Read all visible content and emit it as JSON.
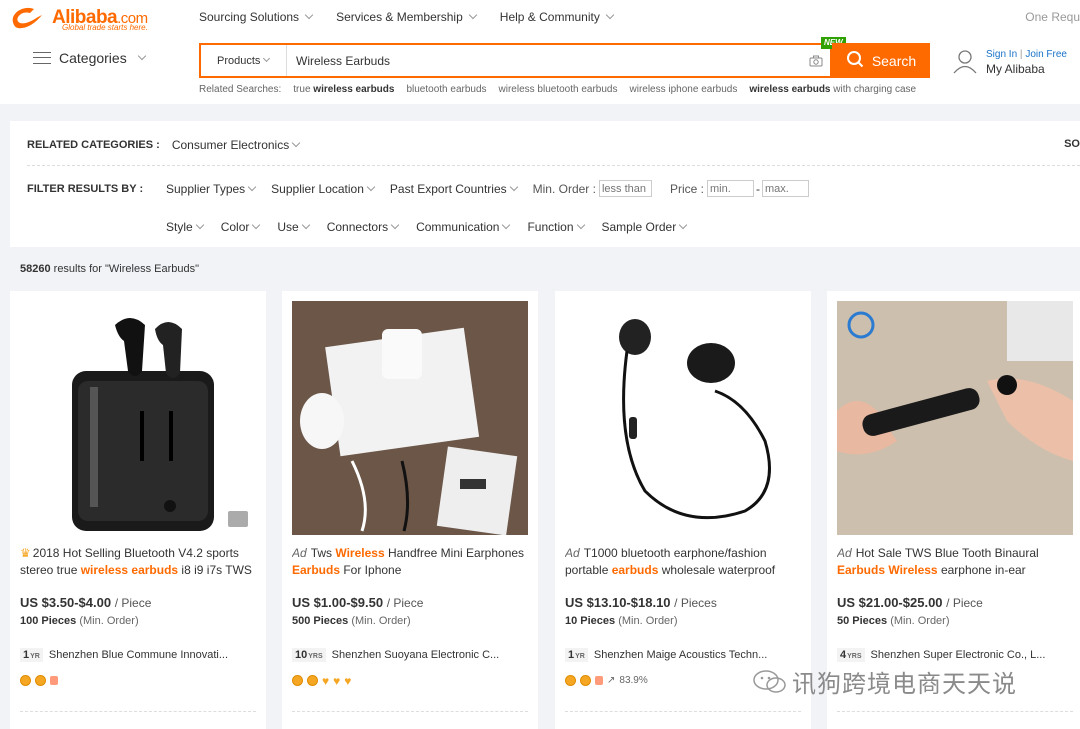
{
  "brand": {
    "name": "Alibaba",
    "suffix": ".com",
    "tagline": "Global trade starts here.",
    "accent": "#ff6a00"
  },
  "topnav": {
    "items": [
      "Sourcing Solutions",
      "Services & Membership",
      "Help & Community"
    ],
    "right": "One Requ"
  },
  "categories_label": "Categories",
  "search": {
    "type": "Products",
    "value": "Wireless Earbuds",
    "button": "Search",
    "new_badge": "NEW"
  },
  "user": {
    "sign_in": "Sign In",
    "join": "Join Free",
    "my": "My Alibaba"
  },
  "related_searches": {
    "label": "Related Searches:",
    "items": [
      {
        "pre": "true ",
        "bold": "wireless earbuds",
        "post": ""
      },
      {
        "pre": "bluetooth earbuds",
        "bold": "",
        "post": ""
      },
      {
        "pre": "wireless bluetooth earbuds",
        "bold": "",
        "post": ""
      },
      {
        "pre": "wireless iphone earbuds",
        "bold": "",
        "post": ""
      },
      {
        "pre": "",
        "bold": "wireless earbuds",
        "post": " with charging case"
      }
    ]
  },
  "filters": {
    "related_label": "RELATED CATEGORIES :",
    "related_value": "Consumer Electronics",
    "right_cut": "SO",
    "filter_label": "FILTER RESULTS BY :",
    "row1": [
      "Supplier Types",
      "Supplier Location",
      "Past Export Countries"
    ],
    "min_order_label": "Min. Order :",
    "min_order_placeholder": "less than",
    "price_label": "Price :",
    "price_min": "min.",
    "price_sep": "-",
    "price_max": "max.",
    "row2": [
      "Style",
      "Color",
      "Use",
      "Connectors",
      "Communication",
      "Function",
      "Sample Order"
    ]
  },
  "results": {
    "count": "58260",
    "text": " results for \"Wireless Earbuds\""
  },
  "products": [
    {
      "ad": "",
      "crown": true,
      "title_parts": [
        {
          "t": "2018 Hot Selling Bluetooth V4.2 sports stereo true ",
          "hl": false
        },
        {
          "t": "wireless earbuds",
          "hl": true
        },
        {
          "t": " i8 i9 i7s TWS",
          "hl": false
        }
      ],
      "price": "US $3.50-$4.00",
      "unit": "/ Piece",
      "moq": "100 Pieces",
      "moq_suffix": "(Min. Order)",
      "years": "1",
      "years_unit": "YR",
      "supplier": "Shenzhen Blue Commune Innovati...",
      "extra": ""
    },
    {
      "ad": "Ad",
      "crown": false,
      "title_parts": [
        {
          "t": "Tws ",
          "hl": false
        },
        {
          "t": "Wireless",
          "hl": true
        },
        {
          "t": " Handfree Mini Earphones ",
          "hl": false
        },
        {
          "t": "Earbuds",
          "hl": true
        },
        {
          "t": " For Iphone",
          "hl": false
        }
      ],
      "price": "US $1.00-$9.50",
      "unit": "/ Piece",
      "moq": "500 Pieces",
      "moq_suffix": "(Min. Order)",
      "years": "10",
      "years_unit": "YRS",
      "supplier": "Shenzhen Suoyana Electronic C...",
      "extra": ""
    },
    {
      "ad": "Ad",
      "crown": false,
      "title_parts": [
        {
          "t": "T1000 bluetooth earphone/fashion portable ",
          "hl": false
        },
        {
          "t": "earbuds",
          "hl": true
        },
        {
          "t": " wholesale waterproof mi...",
          "hl": false
        }
      ],
      "price": "US $13.10-$18.10",
      "unit": "/ Pieces",
      "moq": "10 Pieces",
      "moq_suffix": "(Min. Order)",
      "years": "1",
      "years_unit": "YR",
      "supplier": "Shenzhen Maige Acoustics Techn...",
      "extra": "83.9%"
    },
    {
      "ad": "Ad",
      "crown": false,
      "title_parts": [
        {
          "t": "Hot Sale TWS Blue Tooth Binaural ",
          "hl": false
        },
        {
          "t": "Earbuds Wireless",
          "hl": true
        },
        {
          "t": " earphone in-ear",
          "hl": false
        }
      ],
      "price": "US $21.00-$25.00",
      "unit": "/ Piece",
      "moq": "50 Pieces",
      "moq_suffix": "(Min. Order)",
      "years": "4",
      "years_unit": "YRS",
      "supplier": "Shenzhen Super Electronic Co., L...",
      "extra": ""
    }
  ],
  "watermark": "讯狗跨境电商天天说"
}
